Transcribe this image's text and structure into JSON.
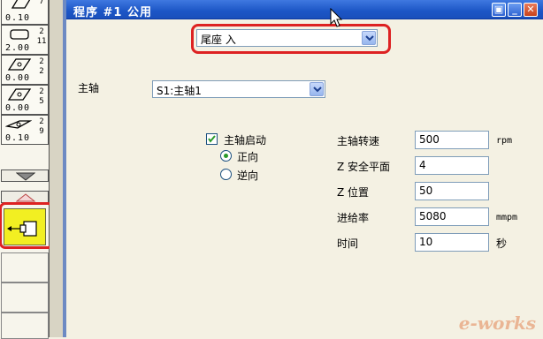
{
  "toolbar_strip": {
    "tools": [
      {
        "value": "0.10",
        "count": "7"
      },
      {
        "value": "2.00",
        "count": "2\n11"
      },
      {
        "value": "0.00",
        "count": "2\n2"
      },
      {
        "value": "0.00",
        "count": "2\n5"
      },
      {
        "value": "0.10",
        "count": "2\n9"
      }
    ]
  },
  "window": {
    "title": "程序 #1 公用"
  },
  "operation": {
    "selected": "尾座 入"
  },
  "spindle": {
    "label": "主轴",
    "selected": "S1:主轴1"
  },
  "spindle_start": {
    "label": "主轴启动",
    "checked": true,
    "directions": [
      {
        "label": "正向",
        "selected": true
      },
      {
        "label": "逆向",
        "selected": false
      }
    ]
  },
  "params": [
    {
      "label": "主轴转速",
      "value": "500",
      "unit": "rpm"
    },
    {
      "label": "Z 安全平面",
      "value": "4",
      "unit": ""
    },
    {
      "label": "Z 位置",
      "value": "50",
      "unit": ""
    },
    {
      "label": "进给率",
      "value": "5080",
      "unit": "mmpm"
    },
    {
      "label": "时间",
      "value": "10",
      "unit": "秒"
    }
  ],
  "watermark": "e-works",
  "colors": {
    "active_tool": "#f2ef22",
    "highlight_ring": "#dd2222",
    "titlebar": "#1c56c6",
    "panel_bg": "#f4f1e3"
  }
}
